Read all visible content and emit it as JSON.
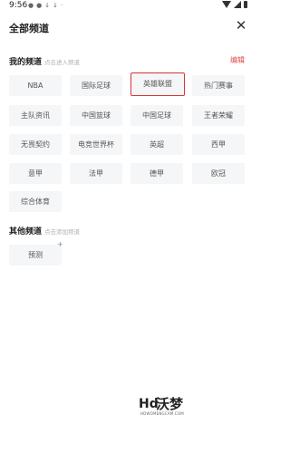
{
  "status_bar": {
    "time": "9:56",
    "left_icons": [
      "notification-icon",
      "notification-icon",
      "download-icon",
      "download-icon",
      "dot"
    ],
    "right_icons": [
      "wifi-icon",
      "signal-icon",
      "battery-icon"
    ]
  },
  "header": {
    "title": "全部频道",
    "close_icon": "close-icon"
  },
  "my_channels": {
    "title": "我的频道",
    "hint": "点击进入频道",
    "edit_label": "编辑",
    "items": [
      {
        "label": "NBA"
      },
      {
        "label": "国际足球"
      },
      {
        "label": "英雄联盟",
        "selected": true
      },
      {
        "label": "热门赛事"
      },
      {
        "label": "主队资讯"
      },
      {
        "label": "中国篮球"
      },
      {
        "label": "中国足球"
      },
      {
        "label": "王者荣耀"
      },
      {
        "label": "无畏契约"
      },
      {
        "label": "电竞世界杯"
      },
      {
        "label": "英超"
      },
      {
        "label": "西甲"
      },
      {
        "label": "意甲"
      },
      {
        "label": "法甲"
      },
      {
        "label": "德甲"
      },
      {
        "label": "欧冠"
      },
      {
        "label": "综合体育"
      }
    ]
  },
  "other_channels": {
    "title": "其他频道",
    "hint": "点击添加频道",
    "items": [
      {
        "label": "预测",
        "badge": "+"
      }
    ]
  },
  "watermark": {
    "prefix": "Hd",
    "name": "沃梦",
    "url": "HDWOMENGCAM.COM"
  },
  "colors": {
    "accent": "#d93434",
    "chip_background": "#f5f6f8"
  }
}
